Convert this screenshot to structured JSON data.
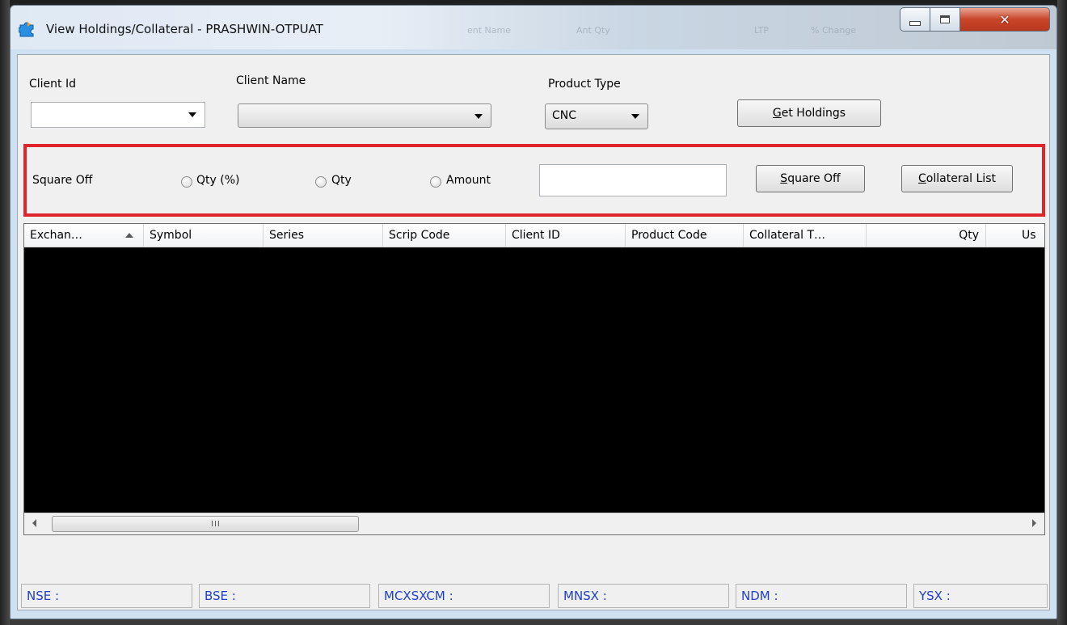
{
  "window": {
    "title": "View Holdings/Collateral - PRASHWIN-OTPUAT",
    "ghost_labels": [
      "ent Name",
      "Ant Qty",
      "LTP",
      "% Change"
    ]
  },
  "form": {
    "client_id_label": "Client Id",
    "client_id_value": "",
    "client_name_label": "Client Name",
    "client_name_value": "",
    "product_type_label": "Product Type",
    "product_type_value": "CNC",
    "get_holdings_pre": "",
    "get_holdings_key": "G",
    "get_holdings_post": "et Holdings"
  },
  "square_off": {
    "label": "Square Off",
    "options": [
      "Qty (%)",
      "Qty",
      "Amount"
    ],
    "value": "",
    "button_key": "S",
    "button_post": "quare Off",
    "collateral_key": "C",
    "collateral_post": "ollateral List"
  },
  "grid": {
    "columns": [
      "Exchan…",
      "Symbol",
      "Series",
      "Scrip Code",
      "Client ID",
      "Product Code",
      "Collateral T…",
      "Qty",
      "Us"
    ],
    "rows": [],
    "scroll_grip": "III"
  },
  "status_bar": [
    "NSE :",
    "BSE :",
    "MCXSXCM :",
    "MNSX :",
    "NDM :",
    "YSX :"
  ],
  "colors": {
    "highlight_border": "#e0242b",
    "status_text": "#1f3fd0",
    "grid_body": "#000000"
  }
}
